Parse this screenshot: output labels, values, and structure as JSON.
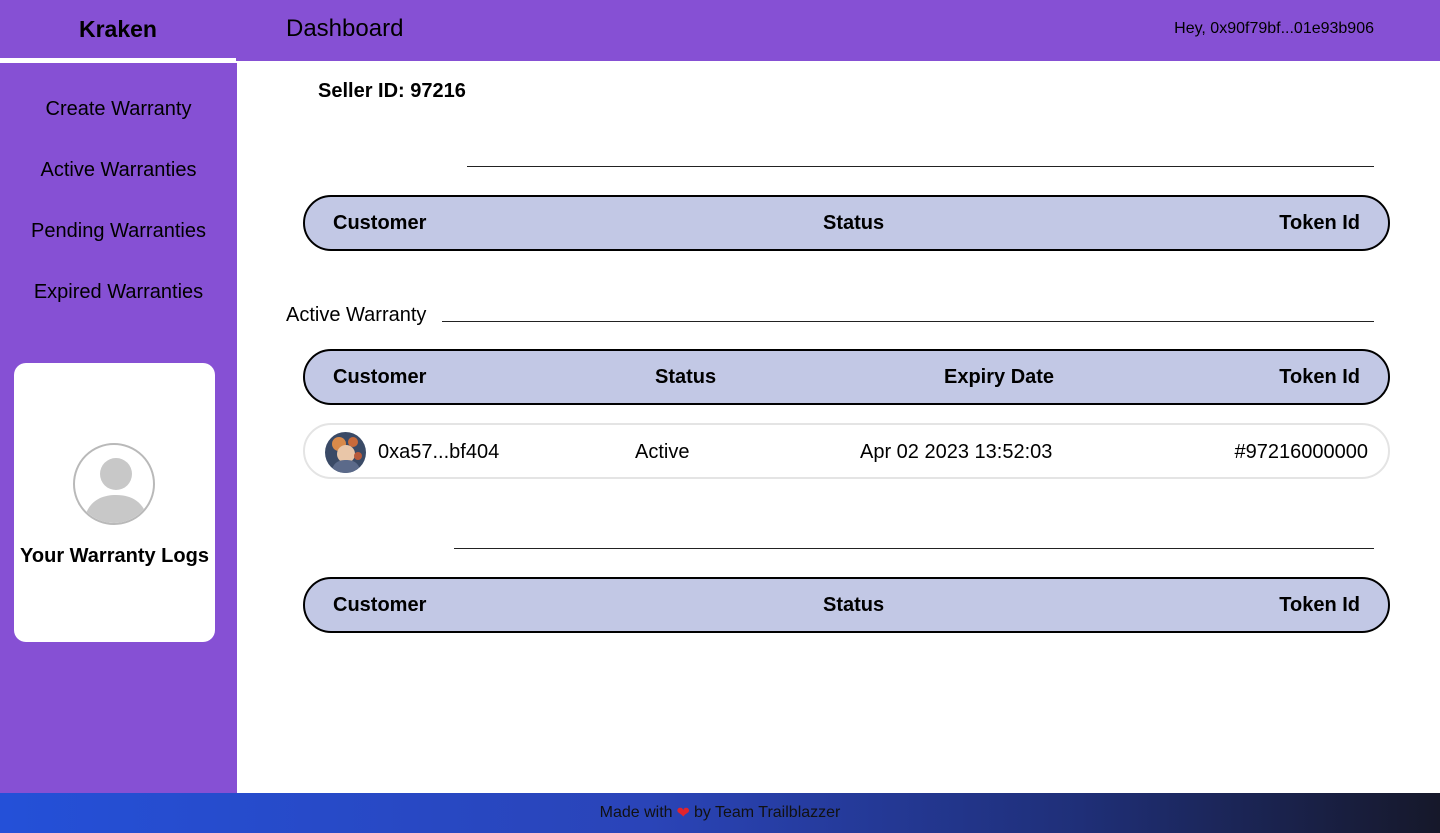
{
  "brand": "Kraken",
  "page_title": "Dashboard",
  "greeting": "Hey, 0x90f79bf...01e93b906",
  "sidebar": {
    "items": [
      {
        "label": "Create Warranty"
      },
      {
        "label": "Active Warranties"
      },
      {
        "label": "Pending Warranties"
      },
      {
        "label": "Expired Warranties"
      }
    ],
    "logs_card": {
      "title": "Your Warranty Logs",
      "icon": "user-avatar-icon"
    }
  },
  "main": {
    "seller_id": "Seller ID: 97216",
    "sections": [
      {
        "label": "",
        "headers": [
          "Customer",
          "Status",
          "Token Id"
        ],
        "rows": []
      },
      {
        "label": "Active Warranty",
        "headers": [
          "Customer",
          "Status",
          "Expiry Date",
          "Token Id"
        ],
        "rows": [
          {
            "customer": "0xa57...bf404",
            "status": "Active",
            "expiry": "Apr 02 2023 13:52:03",
            "token_id": "#97216000000"
          }
        ]
      },
      {
        "label": "",
        "headers": [
          "Customer",
          "Status",
          "Token Id"
        ],
        "rows": []
      }
    ]
  },
  "footer": {
    "before": "Made with",
    "heart": "❤",
    "after": "by Team Trailblazzer"
  },
  "colors": {
    "accent": "#8650d4",
    "table_header": "#c2c8e5",
    "footer_start": "#2450d8",
    "footer_end": "#16182a"
  }
}
